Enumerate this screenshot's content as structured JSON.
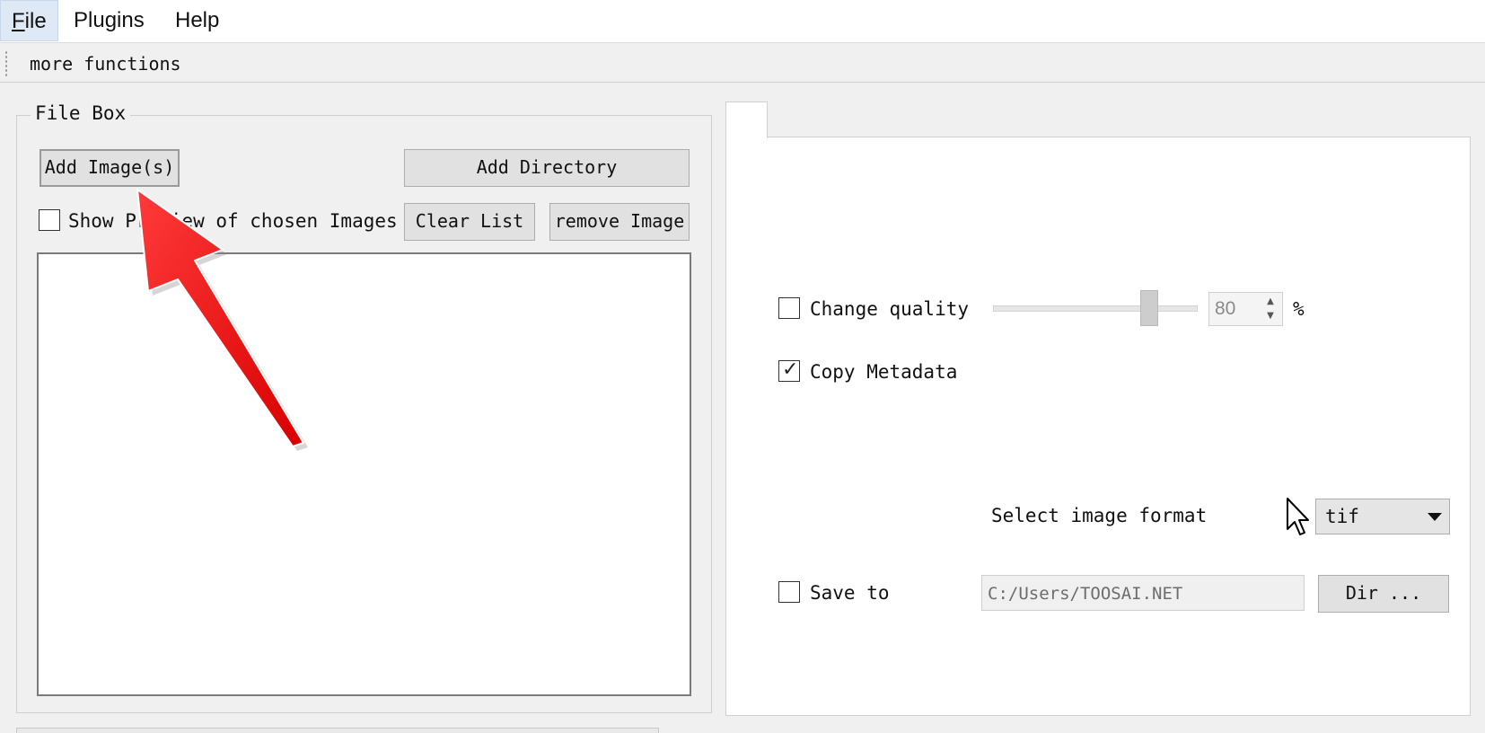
{
  "menubar": {
    "items": [
      {
        "label": "File",
        "accel": "F",
        "rest": "ile"
      },
      {
        "label": "Plugins"
      },
      {
        "label": "Help"
      }
    ]
  },
  "toolbar": {
    "label": "more functions"
  },
  "file_box": {
    "title": "File Box",
    "add_images_label": "Add Image(s)",
    "add_directory_label": "Add Directory",
    "show_preview_label": "Show Preview of chosen Images",
    "show_preview_checked": false,
    "clear_list_label": "Clear List",
    "remove_image_label": "remove Image",
    "file_list_items": []
  },
  "options": {
    "change_quality_label": "Change quality",
    "change_quality_checked": false,
    "quality_value": "80",
    "quality_unit": "%",
    "quality_slider_level": 0.8,
    "copy_metadata_label": "Copy Metadata",
    "copy_metadata_checked": true,
    "select_format_label": "Select image format",
    "format_selected": "tif",
    "save_to_label": "Save to",
    "save_to_checked": false,
    "save_path": "C:/Users/TOOSAI.NET",
    "dir_button_label": "Dir ..."
  },
  "colors": {
    "annotation_arrow": "#ff1010",
    "menu_active": "#dfe9f5"
  },
  "icons": [
    "checkbox-check-icon",
    "chevron-down-icon",
    "spin-up-icon",
    "spin-down-icon",
    "mouse-cursor-icon",
    "annotation-arrow"
  ]
}
